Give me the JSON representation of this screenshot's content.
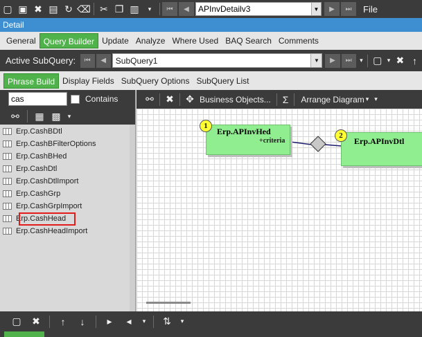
{
  "topbar": {
    "combo_value": "APInvDetailv3",
    "file_label": "File"
  },
  "detail_title": "Detail",
  "main_tabs": [
    {
      "label": "General"
    },
    {
      "label": "Query Builder"
    },
    {
      "label": "Update"
    },
    {
      "label": "Analyze"
    },
    {
      "label": "Where Used"
    },
    {
      "label": "BAQ Search"
    },
    {
      "label": "Comments"
    }
  ],
  "subquery": {
    "label": "Active SubQuery:",
    "value": "SubQuery1"
  },
  "sub_tabs": [
    {
      "label": "Phrase Build"
    },
    {
      "label": "Display Fields"
    },
    {
      "label": "SubQuery Options"
    },
    {
      "label": "SubQuery List"
    }
  ],
  "search": {
    "value": "cas",
    "contains_label": "Contains"
  },
  "tables": [
    "Erp.CashBDtl",
    "Erp.CashBFilterOptions",
    "Erp.CashBHed",
    "Erp.CashDtl",
    "Erp.CashDtlImport",
    "Erp.CashGrp",
    "Erp.CashGrpImport",
    "Erp.CashHead",
    "Erp.CashHeadImport"
  ],
  "diagram_toolbar": {
    "business_objects": "Business Objects...",
    "sigma": "Σ",
    "arrange": "Arrange Diagram"
  },
  "diagram": {
    "node1": {
      "num": "1",
      "name": "Erp.APInvHed",
      "criteria": "+criteria"
    },
    "node2": {
      "num": "2",
      "name": "Erp.APInvDtl"
    }
  },
  "colors": {
    "accent_blue": "#3d8fd1",
    "active_tab_green": "#4fb24a",
    "node_green": "#90ee90",
    "highlight_red": "#e21b1b"
  }
}
